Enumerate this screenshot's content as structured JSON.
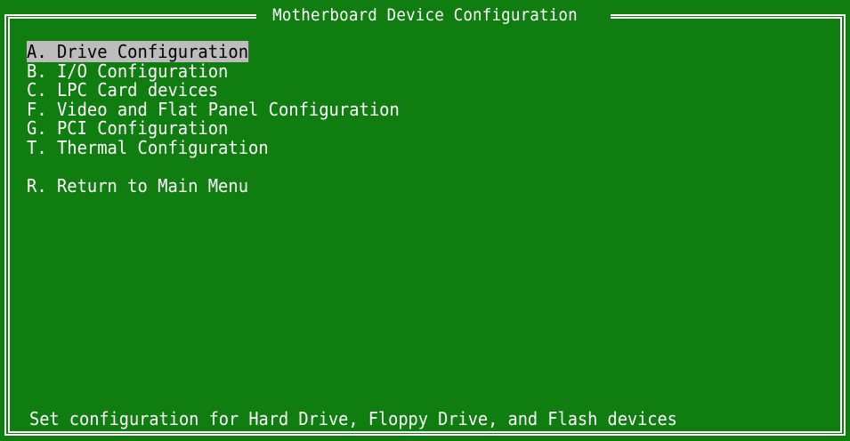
{
  "screen": {
    "title": "Motherboard Device Configuration",
    "background_color": "#0f7d0f",
    "text_color": "#ffffff",
    "highlight_color": "#bdbdbd"
  },
  "menu": {
    "items": [
      {
        "label": "A. Drive Configuration",
        "selected": true
      },
      {
        "label": "B. I/O Configuration",
        "selected": false
      },
      {
        "label": "C. LPC Card devices",
        "selected": false
      },
      {
        "label": "F. Video and Flat Panel Configuration",
        "selected": false
      },
      {
        "label": "G. PCI Configuration",
        "selected": false
      },
      {
        "label": "T. Thermal Configuration",
        "selected": false
      }
    ],
    "return_item": {
      "label": "R. Return to Main Menu"
    }
  },
  "status": {
    "help_text": "Set configuration for Hard Drive, Floppy Drive, and Flash devices"
  }
}
